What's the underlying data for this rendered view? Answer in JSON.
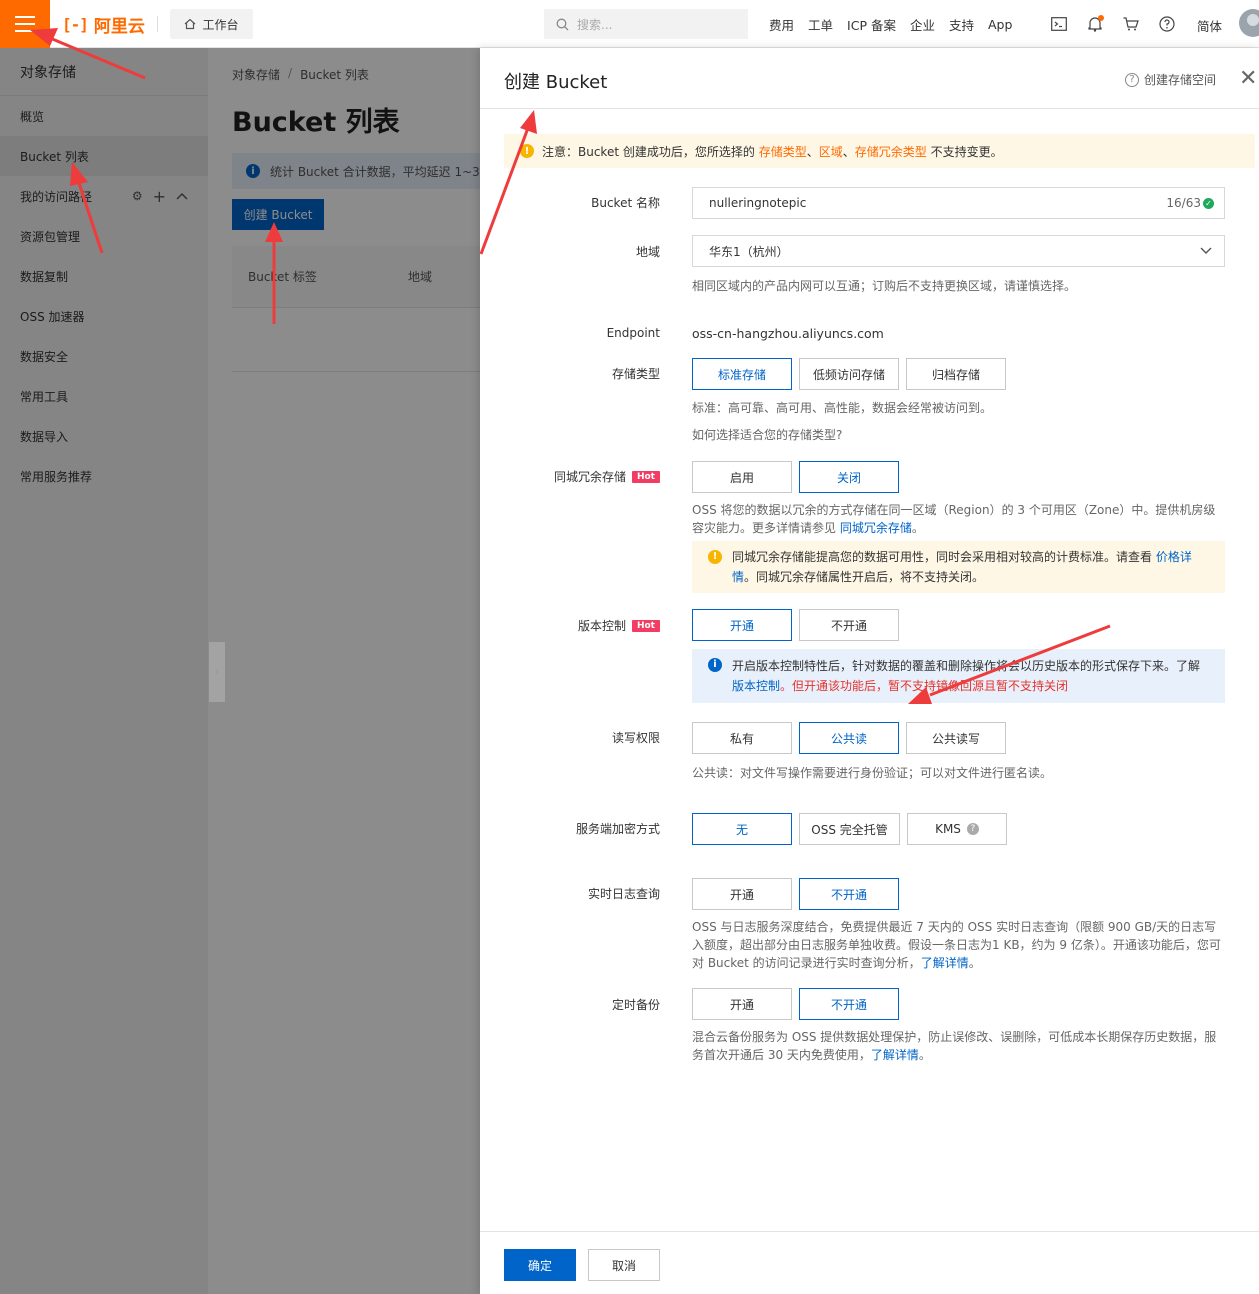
{
  "topbar": {
    "logo_text": "阿里云",
    "workbench": "工作台",
    "search_placeholder": "搜索...",
    "nav": [
      "费用",
      "工单",
      "ICP 备案",
      "企业",
      "支持",
      "App"
    ],
    "lang": "简体"
  },
  "sidebar": {
    "title": "对象存储",
    "items": [
      {
        "label": "概览"
      },
      {
        "label": "Bucket 列表"
      },
      {
        "label": "我的访问路径"
      },
      {
        "label": "资源包管理"
      },
      {
        "label": "数据复制"
      },
      {
        "label": "OSS 加速器"
      },
      {
        "label": "数据安全"
      },
      {
        "label": "常用工具"
      },
      {
        "label": "数据导入"
      },
      {
        "label": "常用服务推荐"
      }
    ]
  },
  "main": {
    "breadcrumb": [
      "对象存储",
      "/",
      "Bucket 列表"
    ],
    "title": "Bucket 列表",
    "notice": "统计 Bucket 合计数据，平均延迟 1~3",
    "create_button": "创建 Bucket",
    "columns": [
      "Bucket 标签",
      "地域"
    ]
  },
  "drawer": {
    "title": "创建 Bucket",
    "help_link": "创建存储空间",
    "warning": {
      "prefix": "注意：Bucket 创建成功后，您所选择的 ",
      "type": "存储类型",
      "sep1": "、",
      "region": "区域",
      "sep2": "、",
      "redundancy": "存储冗余类型",
      "suffix": " 不支持变更。"
    },
    "bucket_name": {
      "label": "Bucket 名称",
      "value": "nulleringnotepic",
      "counter": "16/63"
    },
    "region": {
      "label": "地域",
      "value": "华东1（杭州）",
      "hint": "相同区域内的产品内网可以互通；订购后不支持更换区域，请谨慎选择。"
    },
    "endpoint": {
      "label": "Endpoint",
      "value": "oss-cn-hangzhou.aliyuncs.com"
    },
    "storage_class": {
      "label": "存储类型",
      "options": [
        "标准存储",
        "低频访问存储",
        "归档存储"
      ],
      "hint": "标准：高可靠、高可用、高性能，数据会经常被访问到。",
      "link": "如何选择适合您的存储类型?"
    },
    "zrs": {
      "label": "同城冗余存储",
      "badge": "Hot",
      "options": [
        "启用",
        "关闭"
      ],
      "hint_text": "OSS 将您的数据以冗余的方式存储在同一区域（Region）的 3 个可用区（Zone）中。提供机房级容灾能力。更多详情请参见 ",
      "hint_link": "同城冗余存储",
      "hint_end": "。",
      "tip_text": "同城冗余存储能提高您的数据可用性，同时会采用相对较高的计费标准。请查看 ",
      "tip_link": "价格详情",
      "tip_end": "。同城冗余存储属性开启后，将不支持关闭。"
    },
    "versioning": {
      "label": "版本控制",
      "badge": "Hot",
      "options": [
        "开通",
        "不开通"
      ],
      "tip_text": "开启版本控制特性后，针对数据的覆盖和删除操作将会以历史版本的形式保存下来。了解 ",
      "tip_link": "版本控制",
      "tip_red": "。但开通该功能后，暂不支持镜像回源且暂不支持关闭"
    },
    "acl": {
      "label": "读写权限",
      "options": [
        "私有",
        "公共读",
        "公共读写"
      ],
      "hint": "公共读：对文件写操作需要进行身份验证；可以对文件进行匿名读。"
    },
    "encryption": {
      "label": "服务端加密方式",
      "options": [
        "无",
        "OSS 完全托管",
        "KMS"
      ]
    },
    "realtime_log": {
      "label": "实时日志查询",
      "options": [
        "开通",
        "不开通"
      ],
      "hint_text": "OSS 与日志服务深度结合，免费提供最近 7 天内的 OSS 实时日志查询（限额 900 GB/天的日志写入额度，超出部分由日志服务单独收费。假设一条日志为1 KB，约为 9 亿条）。开通该功能后，您可对 Bucket 的访问记录进行实时查询分析，",
      "hint_link": "了解详情",
      "hint_end": "。"
    },
    "backup": {
      "label": "定时备份",
      "options": [
        "开通",
        "不开通"
      ],
      "hint_text": "混合云备份服务为 OSS 提供数据处理保护，防止误修改、误删除，可低成本长期保存历史数据，服务首次开通后 30 天内免费使用，",
      "hint_link": "了解详情",
      "hint_end": "。"
    },
    "footer": {
      "confirm": "确定",
      "cancel": "取消"
    }
  },
  "colors": {
    "brand": "#ff6a00",
    "primary": "#0064c8",
    "annotation_arrow": "#ee3b3b"
  }
}
